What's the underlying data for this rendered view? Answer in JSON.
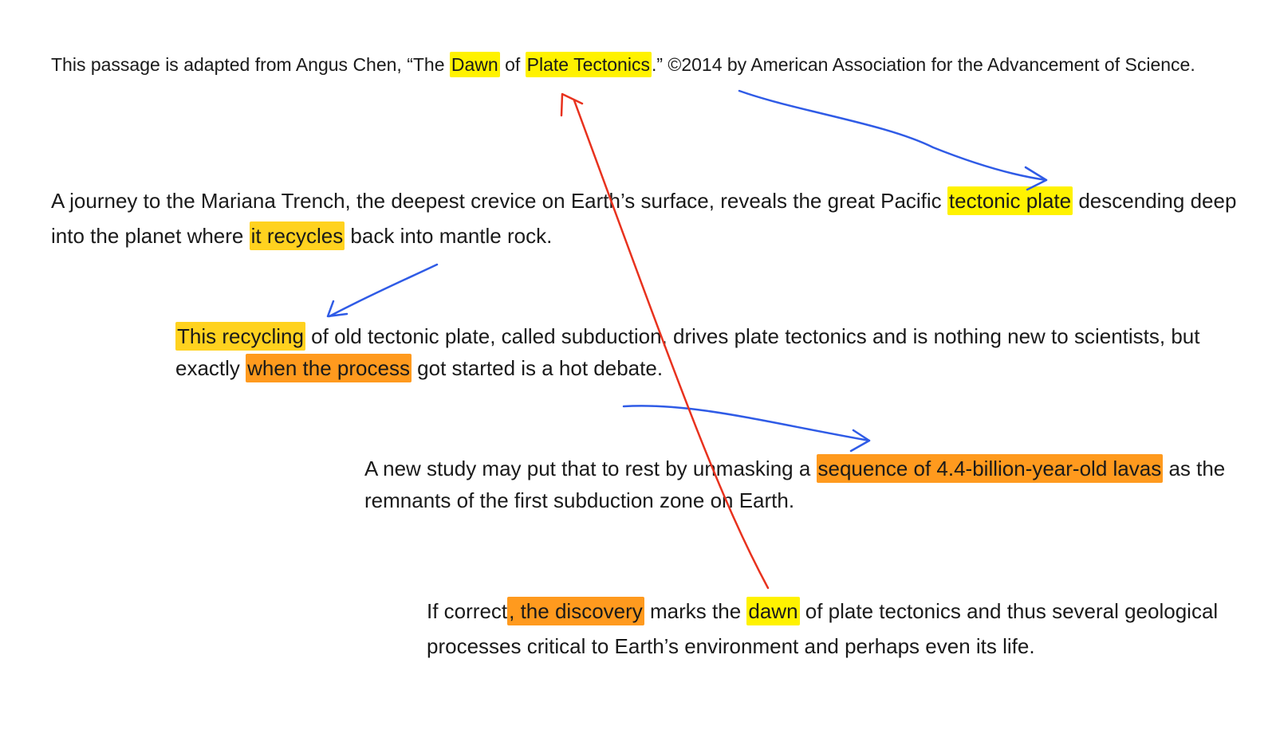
{
  "p0": {
    "s0": "This passage is adapted from Angus Chen, “The ",
    "h0": "Dawn",
    "s1": " of ",
    "h1": "Plate Tectonics",
    "s2": ".” ©2014 by American Association for the Advancement of Science."
  },
  "p1": {
    "s0": "A journey to the Mariana Trench, the deepest crevice on Earth’s surface, reveals the great Pacific ",
    "h0": "tectonic plate",
    "s1": " descending deep into the planet where ",
    "h1": "it recycles",
    "s2": " back into mantle rock."
  },
  "p2": {
    "h0": "This recycling",
    "s0": " of old tectonic plate, called subduction, drives plate tectonics and is nothing new to scientists, but exactly ",
    "h1": "when the process",
    "s1": " got started is a hot debate."
  },
  "p3": {
    "s0": "A new study may put that to rest by unmasking a ",
    "h0": "sequence of 4.4-billion-year-old lavas",
    "s1": " as the remnants of the first subduction zone on Earth."
  },
  "p4": {
    "s0": "If correct",
    "h0": ", the discovery",
    "s1": " marks the ",
    "h1": "dawn",
    "s2": " of plate tectonics and thus several geological processes critical to Earth’s environment and perhaps even its life."
  },
  "colors": {
    "highlight_yellow": "#fff200",
    "highlight_gold": "#ffd21f",
    "highlight_orange": "#ff9a1e",
    "arrow_blue": "#2f5be6",
    "arrow_red": "#e8321e"
  }
}
